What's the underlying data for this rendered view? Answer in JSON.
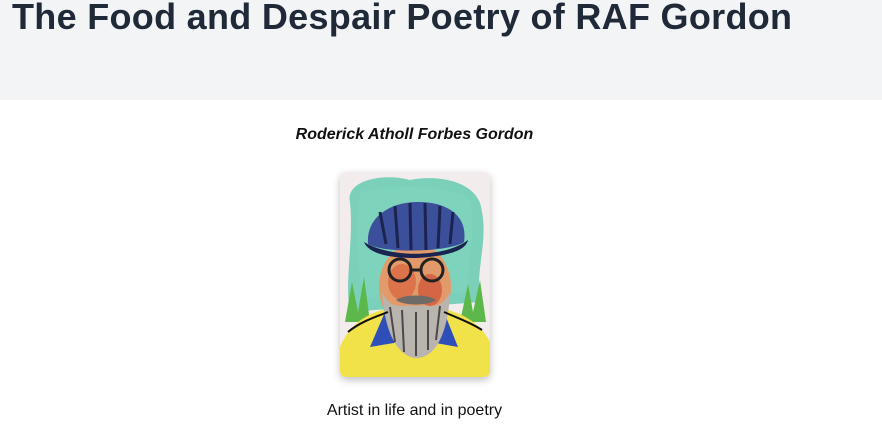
{
  "header": {
    "title": "The Food and Despair Poetry of RAF Gordon"
  },
  "main": {
    "author_name": "Roderick Atholl Forbes Gordon",
    "portrait": {
      "description_icon": "watercolor-portrait-image"
    },
    "tagline": "Artist in life and in poetry"
  },
  "colors": {
    "header_bg": "#f3f4f6",
    "title_text": "#1f2937",
    "body_text": "#111111"
  }
}
